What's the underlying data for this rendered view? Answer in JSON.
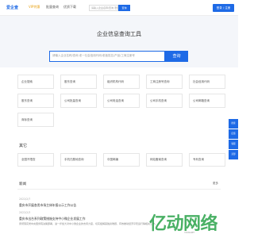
{
  "header": {
    "logo": "爱企查",
    "vip": "VIP特惠",
    "nav_b": "批量查询",
    "nav_c": "优质下载",
    "search_placeholder": "请输入企业名称/查询 老板名字...",
    "search_button": "查询",
    "login_button": "登录 / 注册"
  },
  "hero": {
    "title": "企业信息查询工具",
    "placeholder": "请输入企业名称/查询 老一社会信用代码/老板姓名/产品/工商注册号",
    "button": "查询"
  },
  "tools": [
    "企业搜索",
    "股东查询",
    "组织机构代码",
    "工商注册号查询",
    "社会信用代码",
    "股东查询",
    "公司批量查询",
    "公司电话查询",
    "公司手机查询",
    "公司邮箱查询",
    "商标查询"
  ],
  "side": [
    "搜索",
    "反馈",
    "客服",
    "顶部"
  ],
  "others": {
    "title": "其它",
    "items": [
      "全国不限查",
      "手机归属地查询",
      "中国邮编",
      "网站备案查询",
      "专利查询"
    ]
  },
  "news": {
    "heading": "新闻",
    "more": "更多",
    "items": [
      {
        "date": "2022/2/7",
        "title": "重庆市开展各类市场主体年报公示工作公告",
        "body": ""
      },
      {
        "date": "2022/2/3",
        "title": "重庆市出台系列政策措施支持中小微企业发展工作",
        "body": "贯彻落实党中央国务院决策部署，进一步加大对中小微企业的支持力度，切实缓解其融资难题，有效推动经济平稳运行等相关工作。"
      }
    ]
  },
  "watermark": {
    "text": "亿动网络",
    "small": "YIDONGNET"
  }
}
